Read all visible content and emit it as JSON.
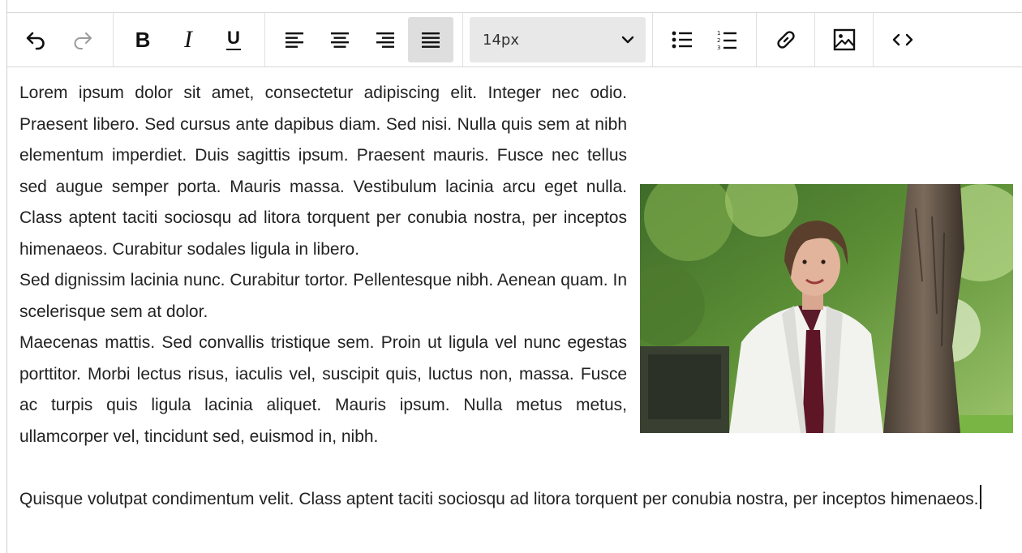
{
  "toolbar": {
    "buttons": {
      "undo": "undo",
      "redo": "redo",
      "bold": "B",
      "italic": "I",
      "underline": "U",
      "align_left": "align-left",
      "align_center": "align-center",
      "align_right": "align-right",
      "align_justify": "align-justify",
      "bullet_list": "bulleted-list",
      "numbered_list": "numbered-list",
      "link": "link",
      "image": "image",
      "code": "code-view"
    },
    "font_size": {
      "value": "14px"
    },
    "active_alignment": "justify"
  },
  "content": {
    "p1": "Lorem ipsum dolor sit amet, consectetur adipiscing elit. Integer nec odio. Praesent libero. Sed cursus ante dapibus diam. Sed nisi. Nulla quis sem at nibh elementum imperdiet. Duis sagittis ipsum. Praesent mauris. Fusce nec tellus sed augue semper porta. Mauris massa. Vestibulum lacinia arcu eget nulla. Class aptent taciti sociosqu ad litora torquent per conubia nostra, per inceptos himenaeos. Curabitur sodales ligula in libero.",
    "p2": "Sed dignissim lacinia nunc. Curabitur tortor. Pellentesque nibh. Aenean quam. In scelerisque sem at dolor.",
    "p3": "Maecenas mattis. Sed convallis tristique sem. Proin ut ligula vel nunc egestas porttitor. Morbi lectus risus, iaculis vel, suscipit quis, luctus non, massa. Fusce ac turpis quis ligula lacinia aliquet. Mauris ipsum. Nulla metus metus, ullamcorper vel, tincidunt sed, euismod in, nibh.",
    "p4": "Quisque volutpat condimentum velit. Class aptent taciti sociosqu ad litora torquent per conubia nostra, per inceptos himenaeos."
  },
  "image": {
    "subject": "woman in white lab coat standing beside a tree trunk"
  },
  "colors": {
    "active_button_bg": "#dedede",
    "select_bg": "#e8e8e8",
    "text": "#222222"
  }
}
